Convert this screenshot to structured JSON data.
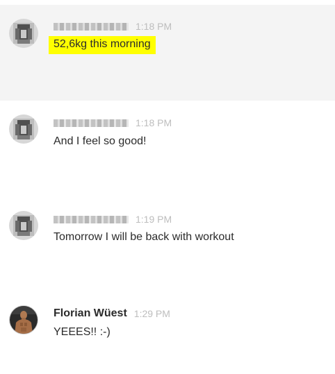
{
  "messages": [
    {
      "author": "",
      "author_blurred": true,
      "time": "1:18 PM",
      "text": "52,6kg this morning",
      "text_highlighted": true,
      "row_highlighted": true,
      "avatar": "pixelated-avatar"
    },
    {
      "author": "",
      "author_blurred": true,
      "time": "1:18 PM",
      "text": "And I feel so good!",
      "text_highlighted": false,
      "row_highlighted": false,
      "avatar": "pixelated-avatar"
    },
    {
      "author": "",
      "author_blurred": true,
      "time": "1:19 PM",
      "text": "Tomorrow I will be back with workout",
      "text_highlighted": false,
      "row_highlighted": false,
      "avatar": "pixelated-avatar"
    },
    {
      "author": "Florian Wüest",
      "author_blurred": false,
      "time": "1:29 PM",
      "text": "YEEES!! :-)",
      "text_highlighted": false,
      "row_highlighted": false,
      "avatar": "profile-photo"
    }
  ],
  "colors": {
    "highlight": "#ffff00",
    "row_highlight": "#f4f4f4",
    "time": "#bdbdbd",
    "text": "#2b2b2b"
  }
}
